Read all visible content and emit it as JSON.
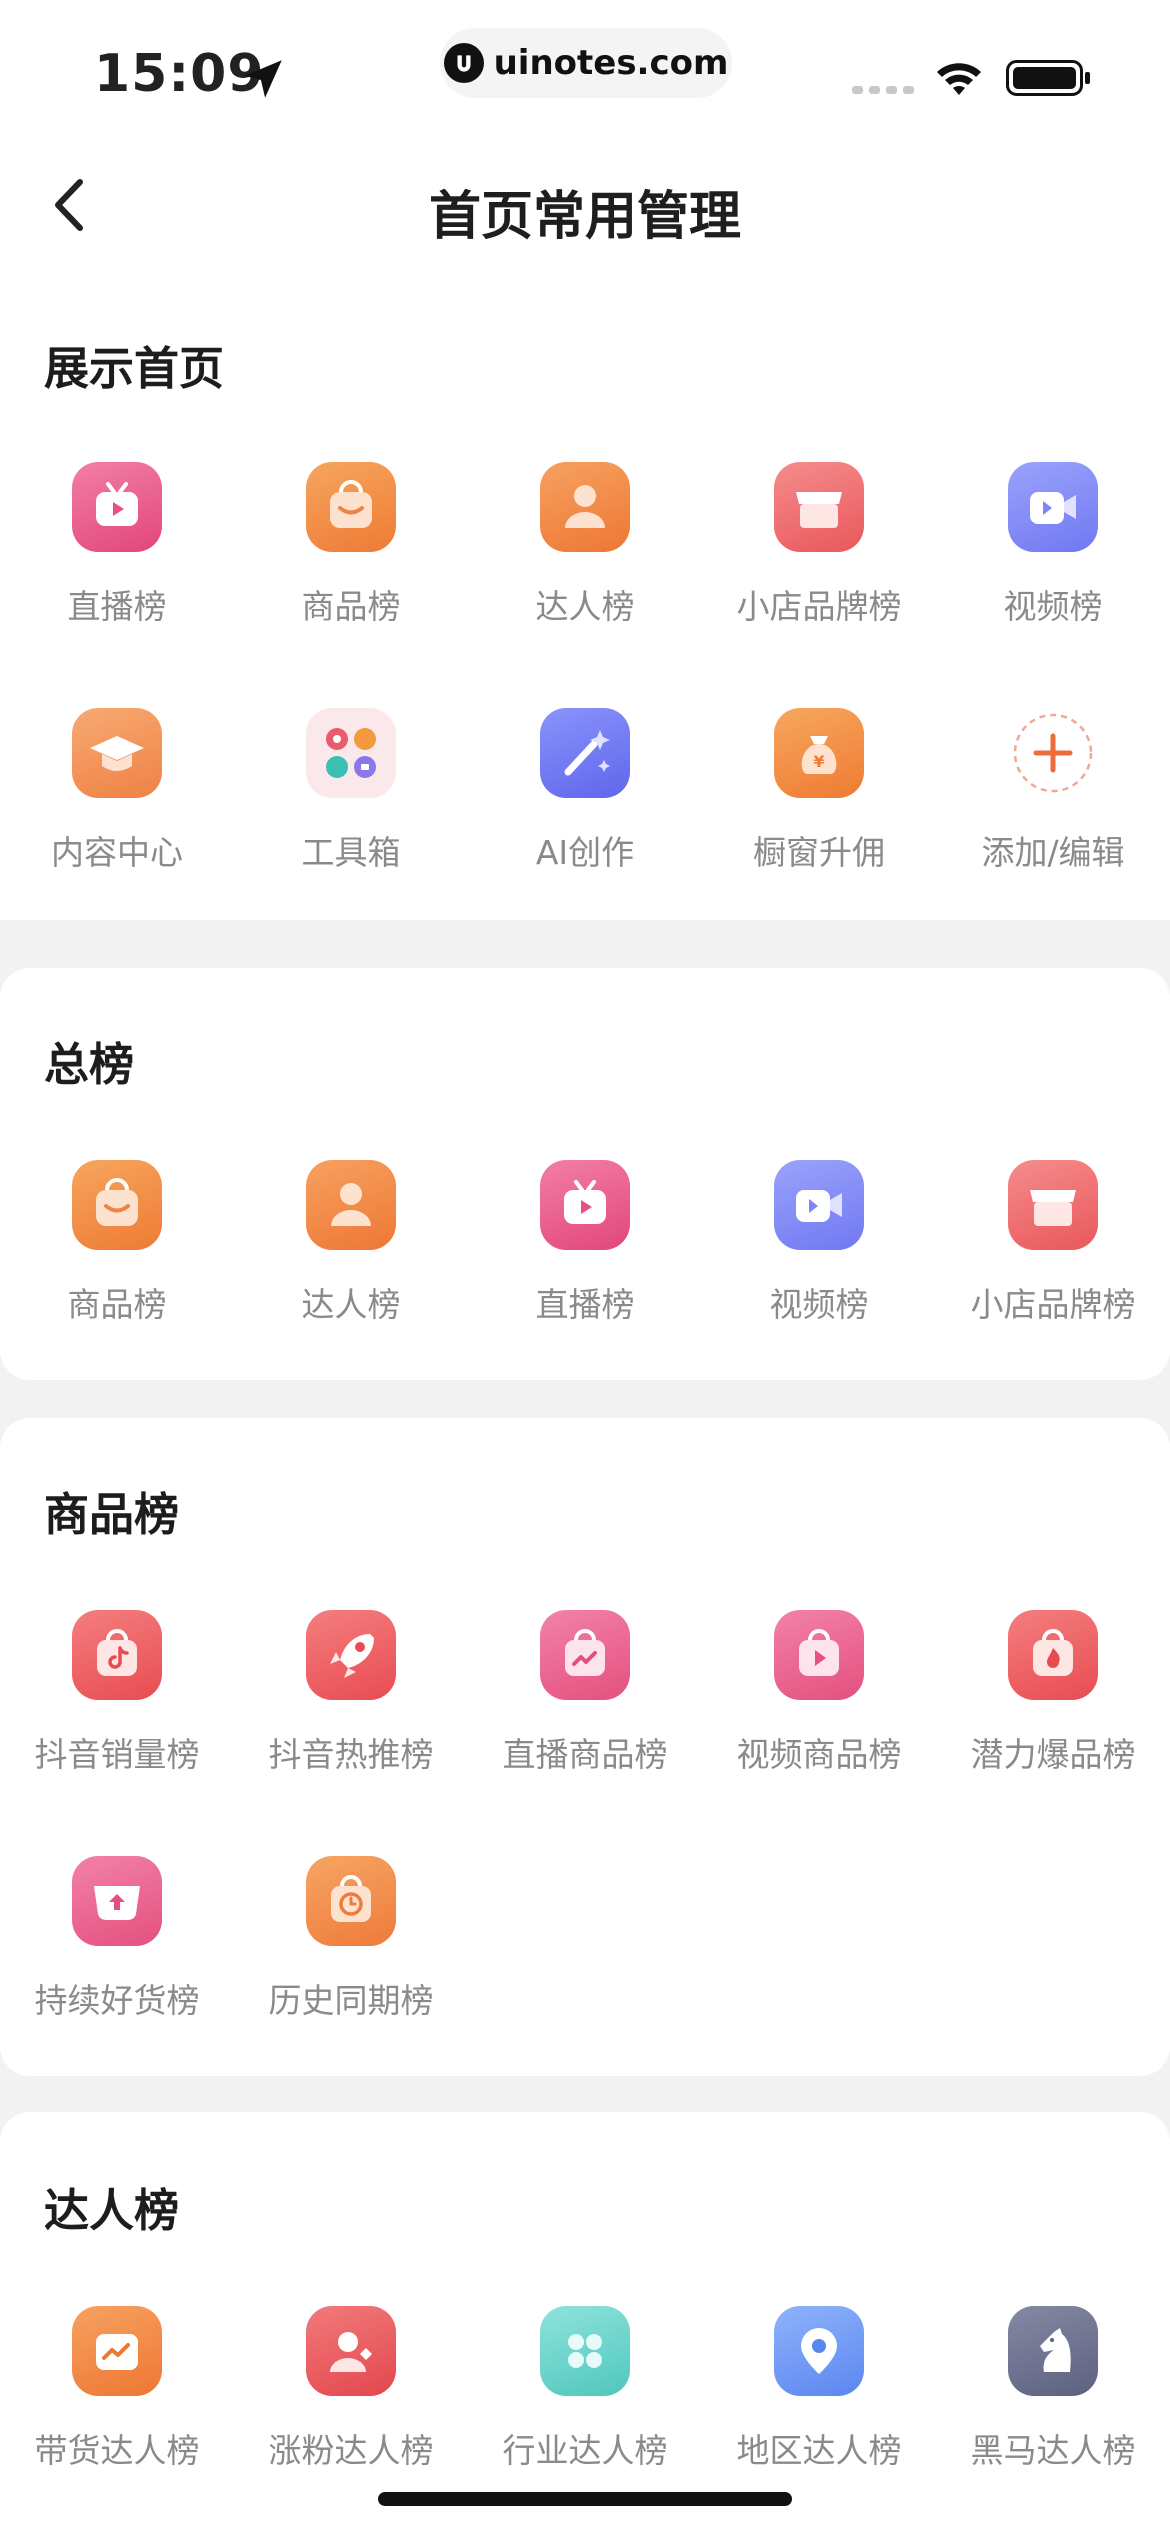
{
  "status_bar": {
    "time": "15:09",
    "url": "uinotes.com"
  },
  "nav": {
    "title": "首页常用管理",
    "back_icon": "chevron-left-icon"
  },
  "sections": [
    {
      "title": "展示首页",
      "items": [
        {
          "label": "直播榜",
          "icon": "live-tv-icon"
        },
        {
          "label": "商品榜",
          "icon": "shopping-bag-icon"
        },
        {
          "label": "达人榜",
          "icon": "person-icon"
        },
        {
          "label": "小店品牌榜",
          "icon": "store-icon"
        },
        {
          "label": "视频榜",
          "icon": "video-camera-icon"
        },
        {
          "label": "内容中心",
          "icon": "graduation-cap-icon"
        },
        {
          "label": "工具箱",
          "icon": "toolbox-grid-icon"
        },
        {
          "label": "AI创作",
          "icon": "magic-wand-icon"
        },
        {
          "label": "橱窗升佣",
          "icon": "money-bag-icon"
        },
        {
          "label": "添加/编辑",
          "icon": "add-icon"
        }
      ]
    },
    {
      "title": "总榜",
      "items": [
        {
          "label": "商品榜",
          "icon": "shopping-bag-icon"
        },
        {
          "label": "达人榜",
          "icon": "person-icon"
        },
        {
          "label": "直播榜",
          "icon": "live-tv-icon"
        },
        {
          "label": "视频榜",
          "icon": "video-camera-icon"
        },
        {
          "label": "小店品牌榜",
          "icon": "store-icon"
        }
      ]
    },
    {
      "title": "商品榜",
      "items": [
        {
          "label": "抖音销量榜",
          "icon": "tiktok-bag-icon"
        },
        {
          "label": "抖音热推榜",
          "icon": "rocket-icon"
        },
        {
          "label": "直播商品榜",
          "icon": "trend-bag-icon"
        },
        {
          "label": "视频商品榜",
          "icon": "play-bag-icon"
        },
        {
          "label": "潜力爆品榜",
          "icon": "fire-bag-icon"
        },
        {
          "label": "持续好货榜",
          "icon": "upload-bag-icon"
        },
        {
          "label": "历史同期榜",
          "icon": "clock-bag-icon"
        }
      ]
    },
    {
      "title": "达人榜",
      "items": [
        {
          "label": "带货达人榜",
          "icon": "sales-chart-icon"
        },
        {
          "label": "涨粉达人榜",
          "icon": "person-growth-icon"
        },
        {
          "label": "行业达人榜",
          "icon": "clover-icon"
        },
        {
          "label": "地区达人榜",
          "icon": "location-pin-icon"
        },
        {
          "label": "黑马达人榜",
          "icon": "horse-icon"
        }
      ]
    }
  ],
  "colors": {
    "accent_orange": "#f0823a",
    "accent_pink": "#e9558a",
    "accent_blue": "#7d86f6",
    "label_gray": "#8a8a8a",
    "background": "#f2f2f2"
  }
}
